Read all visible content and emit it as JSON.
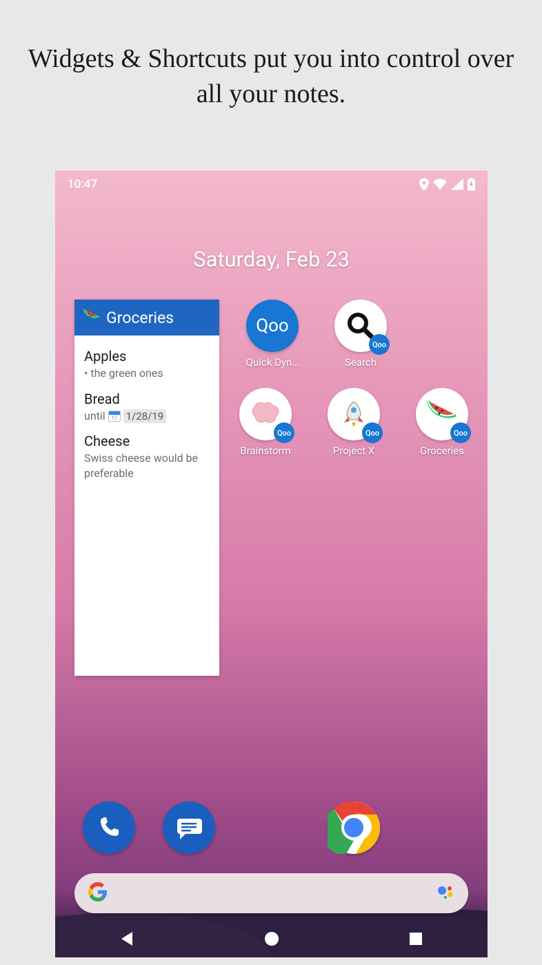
{
  "promo": {
    "headline": "Widgets & Shortcuts put you into control over all your notes."
  },
  "status": {
    "time": "10:47"
  },
  "homescreen": {
    "date": "Saturday, Feb 23"
  },
  "widget": {
    "title": "Groceries",
    "items": [
      {
        "title": "Apples",
        "sub": "•  the green ones"
      },
      {
        "title": "Bread",
        "until": "until",
        "date": "1/28/19"
      },
      {
        "title": "Cheese",
        "sub": "Swiss cheese would be preferable"
      }
    ]
  },
  "shortcuts": {
    "row1": [
      {
        "label": "Quick Dyn…",
        "type": "qoo"
      },
      {
        "label": "Search",
        "type": "search"
      }
    ],
    "row2": [
      {
        "label": "Brainstorm",
        "type": "brain"
      },
      {
        "label": "Project X",
        "type": "rocket"
      },
      {
        "label": "Groceries",
        "type": "watermelon"
      }
    ],
    "badge": "Qoo"
  },
  "dock": {
    "phone": "Phone",
    "messages": "Messages",
    "chrome": "Chrome"
  }
}
